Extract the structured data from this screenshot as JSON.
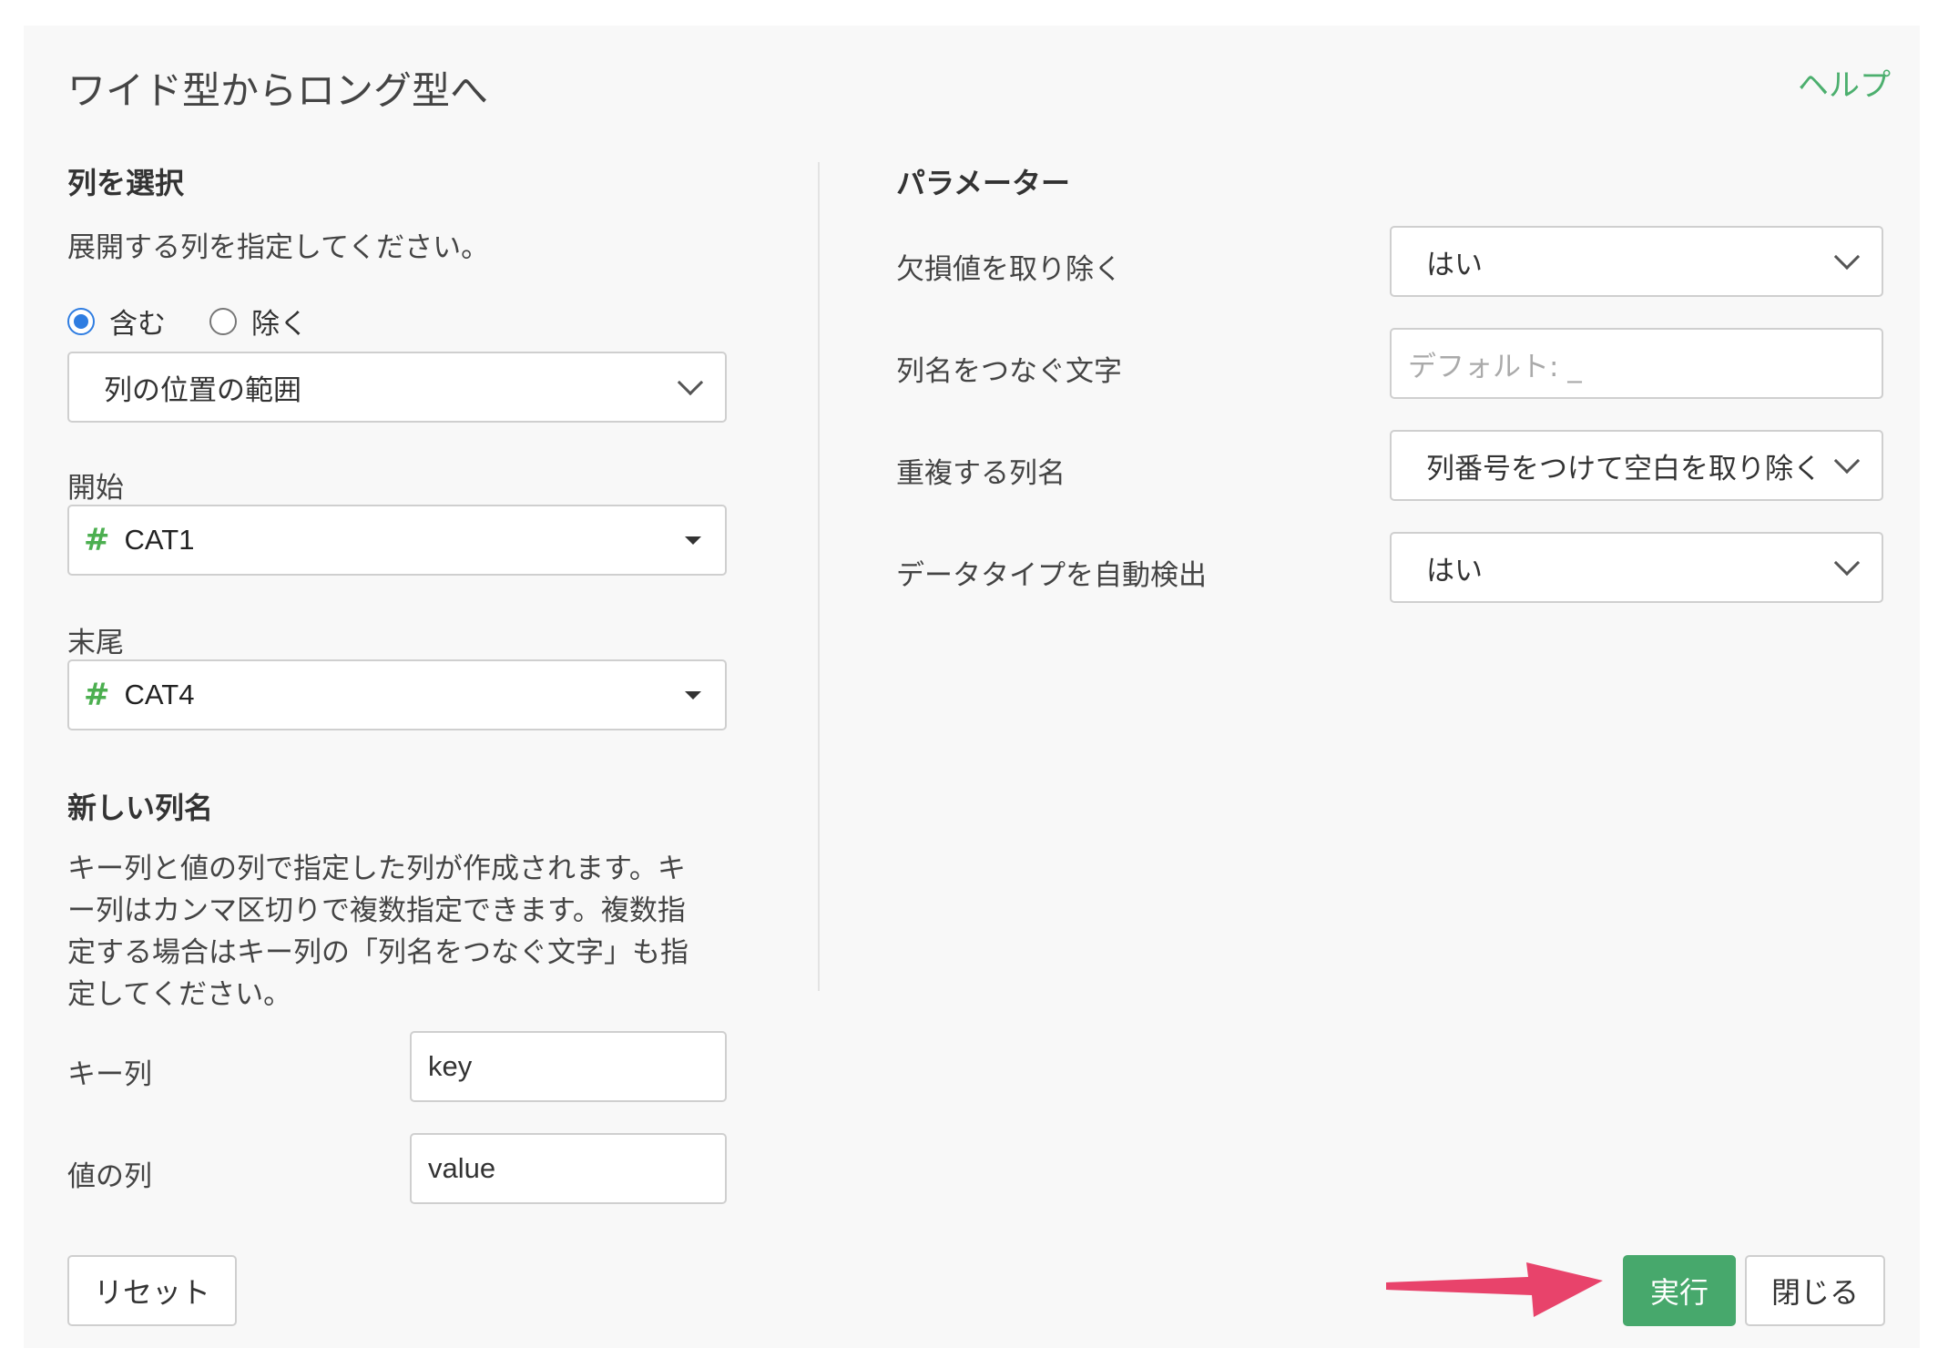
{
  "dialog": {
    "title": "ワイド型からロング型へ",
    "help": "ヘルプ"
  },
  "left": {
    "select_columns_title": "列を選択",
    "select_columns_desc": "展開する列を指定してください。",
    "radio": {
      "include": "含む",
      "exclude": "除く",
      "selected": "include"
    },
    "range_select": "列の位置の範囲",
    "start_label": "開始",
    "start_column": "CAT1",
    "end_label": "末尾",
    "end_column": "CAT4",
    "new_columns_title": "新しい列名",
    "new_columns_desc_1": "キー列と値の列で指定した列が作成されます。キ",
    "new_columns_desc_2": "ー列はカンマ区切りで複数指定できます。複数指",
    "new_columns_desc_3": "定する場合はキー列の「列名をつなぐ文字」も指",
    "new_columns_desc_4": "定してください。",
    "key_label": "キー列",
    "key_value": "key",
    "value_label": "値の列",
    "value_value": "value"
  },
  "right": {
    "params_title": "パラメーター",
    "remove_na_label": "欠損値を取り除く",
    "remove_na_value": "はい",
    "sep_label": "列名をつなぐ文字",
    "sep_placeholder": "デフォルト: _",
    "dup_label": "重複する列名",
    "dup_value": "列番号をつけて空白を取り除く",
    "auto_type_label": "データタイプを自動検出",
    "auto_type_value": "はい"
  },
  "buttons": {
    "reset": "リセット",
    "run": "実行",
    "close": "閉じる"
  },
  "colors": {
    "primary": "#47a86c",
    "link": "#4caf6e",
    "radio": "#2f7de1",
    "arrow": "#e8436b"
  }
}
